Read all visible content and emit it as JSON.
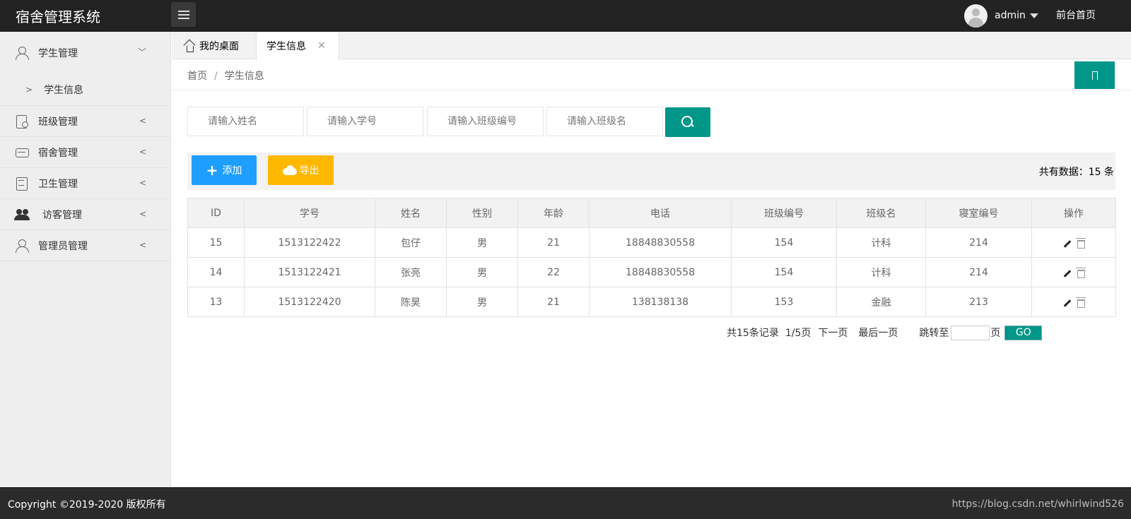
{
  "header": {
    "brand": "宿舍管理系统",
    "username": "admin",
    "front_link": "前台首页"
  },
  "sidebar": {
    "items": [
      {
        "label": "学生管理",
        "icon": "user-icon",
        "expanded": true,
        "children": [
          {
            "label": "学生信息"
          }
        ]
      },
      {
        "label": "班级管理",
        "icon": "class-doc-icon"
      },
      {
        "label": "宿舍管理",
        "icon": "sofa-icon"
      },
      {
        "label": "卫生管理",
        "icon": "list-icon"
      },
      {
        "label": "访客管理",
        "icon": "users-icon"
      },
      {
        "label": "管理员管理",
        "icon": "admin-icon"
      }
    ]
  },
  "tabs": {
    "home": "我的桌面",
    "current": "学生信息",
    "close_glyph": "✕"
  },
  "breadcrumb": {
    "home": "首页",
    "separator": "/",
    "current": "学生信息"
  },
  "search": {
    "name_placeholder": "请输入姓名",
    "student_no_placeholder": "请输入学号",
    "class_no_placeholder": "请输入班级编号",
    "class_name_placeholder": "请输入班级名"
  },
  "toolbar": {
    "add_label": "添加",
    "export_label": "导出",
    "total_text": "共有数据：15 条"
  },
  "table": {
    "headers": [
      "ID",
      "学号",
      "姓名",
      "性别",
      "年龄",
      "电话",
      "班级编号",
      "班级名",
      "寝室编号",
      "操作"
    ],
    "rows": [
      [
        "15",
        "1513122422",
        "包仔",
        "男",
        "21",
        "18848830558",
        "154",
        "计科",
        "214"
      ],
      [
        "14",
        "1513122421",
        "张亮",
        "男",
        "22",
        "18848830558",
        "154",
        "计科",
        "214"
      ],
      [
        "13",
        "1513122420",
        "陈昊",
        "男",
        "21",
        "138138138",
        "153",
        "金融",
        "213"
      ]
    ]
  },
  "pagination": {
    "records": "共15条记录",
    "page_info": "1/5页",
    "next": "下一页",
    "last": "最后一页",
    "jump_to": "跳转至",
    "page_unit": "页",
    "go": "GO"
  },
  "footer": {
    "copyright": "Copyright ©2019-2020 版权所有",
    "watermark": "https://blog.csdn.net/whirlwind526"
  },
  "colors": {
    "header_bg": "#222222",
    "primary": "#009688",
    "add_button": "#1e9fff",
    "export_button": "#ffb800"
  }
}
